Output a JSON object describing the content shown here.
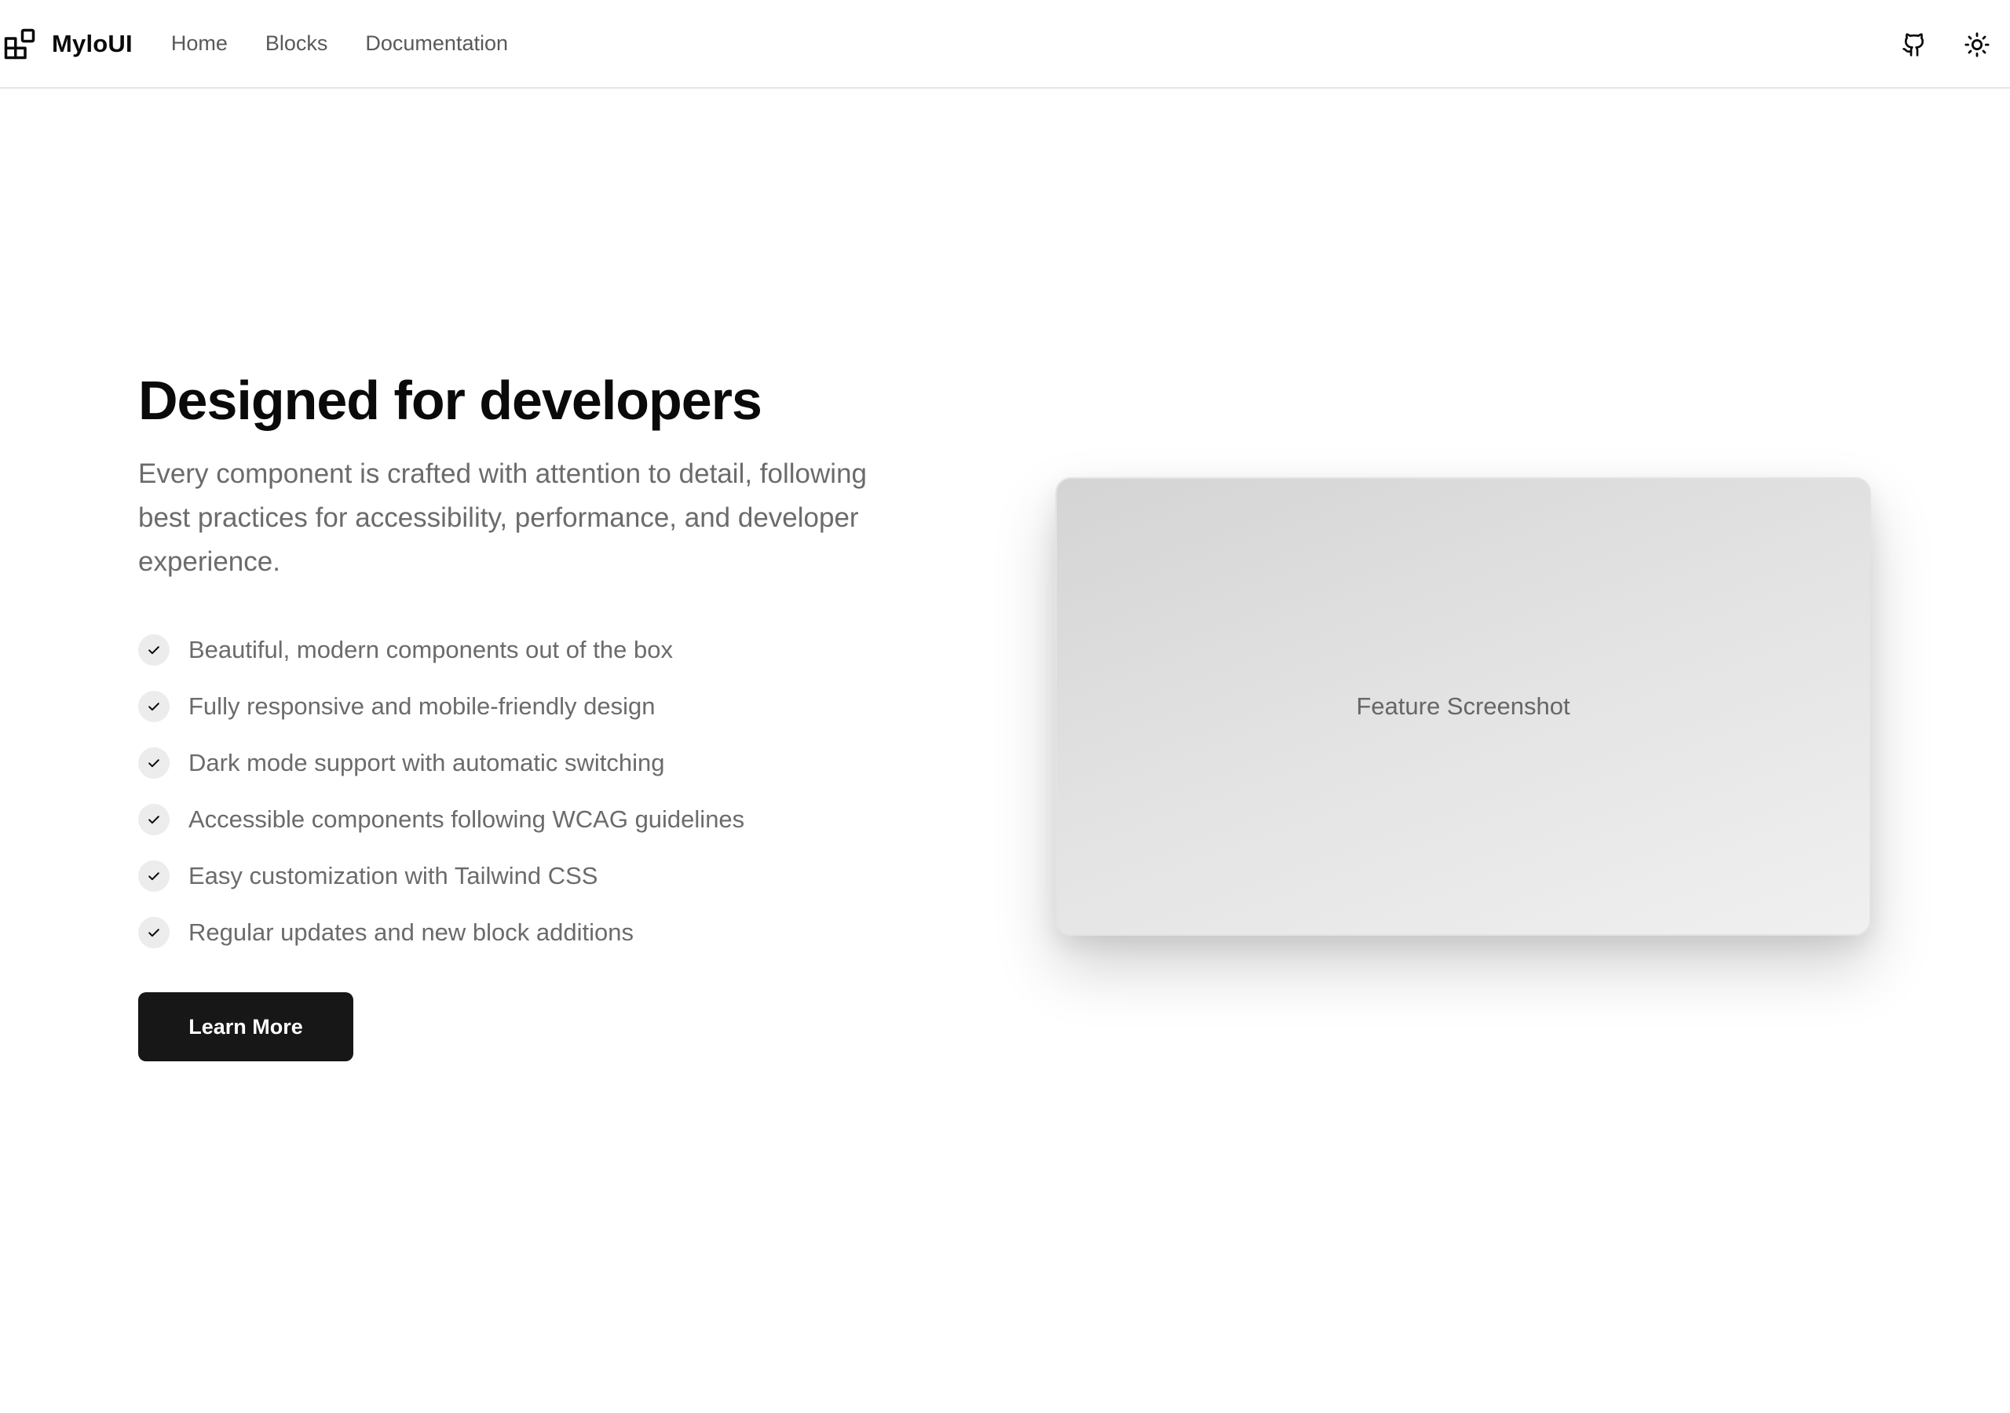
{
  "header": {
    "brand": "MyloUI",
    "nav": [
      {
        "label": "Home"
      },
      {
        "label": "Blocks"
      },
      {
        "label": "Documentation"
      }
    ],
    "actions": {
      "github_icon": "github-icon",
      "theme_icon": "sun-icon"
    }
  },
  "feature": {
    "title": "Designed for developers",
    "description": "Every component is crafted with attention to detail, following best practices for accessibility, performance, and developer experience.",
    "items": [
      "Beautiful, modern components out of the box",
      "Fully responsive and mobile-friendly design",
      "Dark mode support with automatic switching",
      "Accessible components following WCAG guidelines",
      "Easy customization with Tailwind CSS",
      "Regular updates and new block additions"
    ],
    "cta_label": "Learn More",
    "screenshot_label": "Feature Screenshot"
  },
  "colors": {
    "primary": "#171717",
    "muted_text": "#6b6b6b",
    "nav_text": "#595959",
    "border": "#e5e5e5"
  }
}
